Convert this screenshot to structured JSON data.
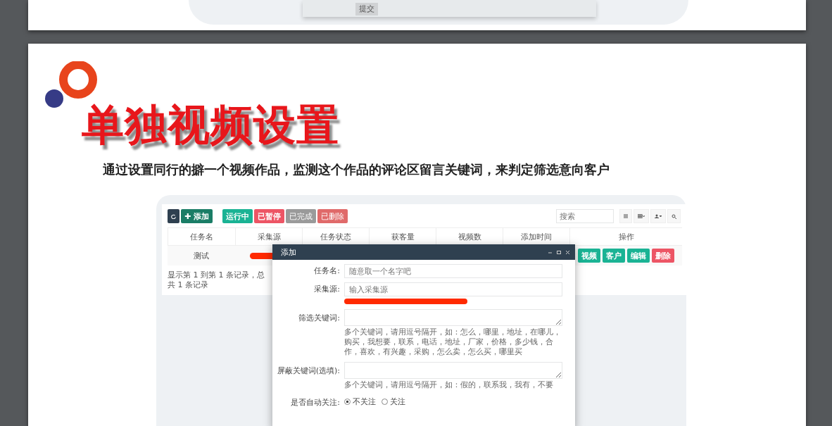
{
  "top_section": {
    "submit_button": "提交"
  },
  "title": "单独视频设置",
  "subtitle": "通过设置同行的擗一个视频作品，监测这个作品的评论区留言关键词，来判定筛选意向客户",
  "toolbar": {
    "add_button": "✚ 添加",
    "filters": [
      {
        "label": "运行中",
        "color": "#1ab394",
        "disabled": false
      },
      {
        "label": "已暂停",
        "color": "#ed5565",
        "disabled": false
      },
      {
        "label": "已完成",
        "color": "#9a9a9a",
        "disabled": true
      },
      {
        "label": "已删除",
        "color": "#e06a6a",
        "disabled": true
      }
    ],
    "search": {
      "placeholder": "搜索"
    }
  },
  "table": {
    "columns": [
      "任务名",
      "采集源",
      "任务状态",
      "获客量",
      "视频数",
      "添加时间",
      "操作"
    ],
    "rows": [
      {
        "name": "测试",
        "actions": [
          {
            "label": "视频",
            "kind": "primary"
          },
          {
            "label": "客户",
            "kind": "primary"
          },
          {
            "label": "编辑",
            "kind": "primary"
          },
          {
            "label": "删除",
            "kind": "danger"
          }
        ]
      }
    ],
    "footer": "显示第 1 到第 1 条记录，总共 1 条记录"
  },
  "dialog": {
    "title": "添加",
    "fields": [
      {
        "kind": "input",
        "label": "任务名:",
        "placeholder": "随意取一个名字吧"
      },
      {
        "kind": "input",
        "label": "采集源:",
        "placeholder": "输入采集源",
        "redacted": true
      },
      {
        "kind": "textarea",
        "label": "筛选关键词:",
        "help": "多个关键词，请用逗号隔开，如：怎么，哪里，地址，在哪儿，购买，我想要，联系，电话，地址，厂家，价格，多少钱，合作，喜欢，有兴趣，采购，怎么卖，怎么买，哪里买"
      },
      {
        "kind": "textarea",
        "label": "屏蔽关键词(选填):",
        "help": "多个关键词，请用逗号隔开，如：假的，联系我，我有，不要"
      },
      {
        "kind": "radio",
        "label": "是否自动关注:",
        "options": [
          {
            "label": "不关注",
            "selected": true
          },
          {
            "label": "关注",
            "selected": false
          }
        ]
      }
    ]
  }
}
